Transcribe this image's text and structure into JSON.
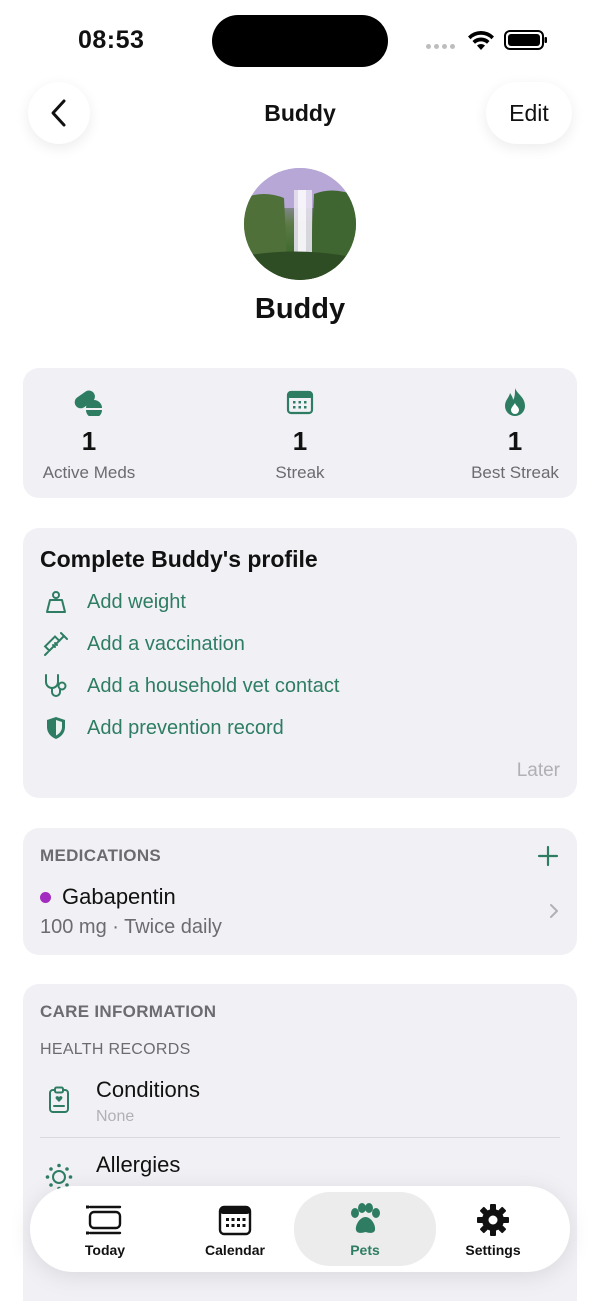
{
  "status": {
    "time": "08:53"
  },
  "header": {
    "title": "Buddy",
    "edit_label": "Edit"
  },
  "pet": {
    "name": "Buddy"
  },
  "stats": [
    {
      "value": "1",
      "label": "Active Meds",
      "icon": "pill-icon"
    },
    {
      "value": "1",
      "label": "Streak",
      "icon": "calendar-icon"
    },
    {
      "value": "1",
      "label": "Best Streak",
      "icon": "flame-icon"
    }
  ],
  "profile": {
    "title": "Complete Buddy's profile",
    "tasks": [
      {
        "label": "Add weight",
        "icon": "weight-icon"
      },
      {
        "label": "Add a vaccination",
        "icon": "syringe-icon"
      },
      {
        "label": "Add a household vet contact",
        "icon": "stethoscope-icon"
      },
      {
        "label": "Add prevention record",
        "icon": "shield-icon"
      }
    ],
    "later_label": "Later"
  },
  "medications": {
    "section_label": "MEDICATIONS",
    "items": [
      {
        "name": "Gabapentin",
        "detail": "100 mg · Twice daily",
        "dot_color": "#a22bc0"
      }
    ]
  },
  "care": {
    "section_label": "CARE INFORMATION",
    "sub_label": "HEALTH RECORDS",
    "rows": [
      {
        "title": "Conditions",
        "subtitle": "None",
        "icon": "clipboard-icon"
      },
      {
        "title": "Allergies",
        "subtitle": "",
        "icon": "allergen-icon"
      }
    ]
  },
  "tabs": [
    {
      "label": "Today",
      "icon": "stack-icon",
      "active": false
    },
    {
      "label": "Calendar",
      "icon": "calendar-icon",
      "active": false
    },
    {
      "label": "Pets",
      "icon": "paw-icon",
      "active": true
    },
    {
      "label": "Settings",
      "icon": "gear-icon",
      "active": false
    }
  ],
  "colors": {
    "accent": "#2e7d63",
    "card_bg": "#f1f1f5",
    "med_dot": "#a22bc0"
  }
}
